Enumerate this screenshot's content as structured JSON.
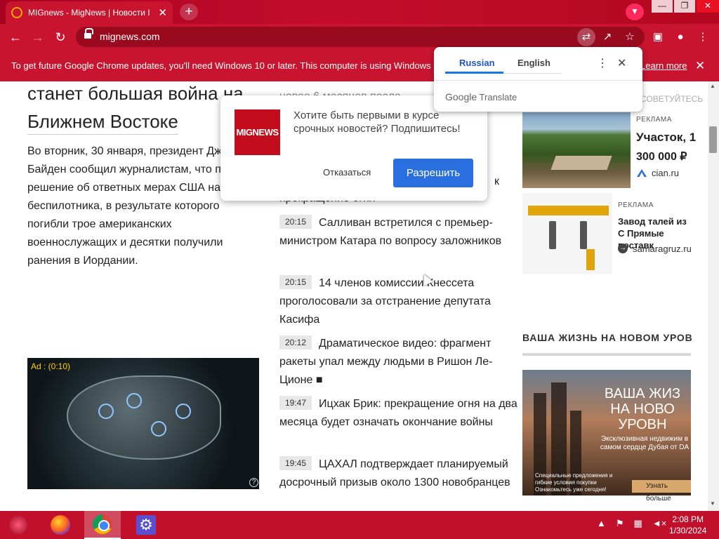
{
  "browser": {
    "tab_title": "MIGnews - MigNews | Новости I",
    "tab_close": "✕",
    "new_tab": "+",
    "url": "mignews.com",
    "window_controls": [
      "—",
      "❐",
      "✕"
    ]
  },
  "infobar": {
    "message": "To get future Google Chrome updates, you'll need Windows 10 or later. This computer is using Windows a",
    "link": "Learn more",
    "close": "✕"
  },
  "article": {
    "headline_line1": "станет большая война на",
    "headline_line2": "Ближнем Востоке",
    "lead": "Во вторник, 30 января,  президент Дж Байден сообщил журналистам, что п решение об ответных мерах США на беспилотника, в результате которого погибли трое американских военнослужащих и десятки получили ранения в Иордании."
  },
  "video_ad": {
    "timer": "Ad : (0:10)",
    "help": "?"
  },
  "news_fragments": {
    "top": "новее 6 месяцев после",
    "mid1": "к",
    "mid2": "прекращение огня"
  },
  "news": [
    {
      "time": "20:15",
      "text": "Салливан встретился с премьер-министром Катара по вопросу заложников"
    },
    {
      "time": "20:15",
      "text": "14 членов комиссии Кнессета проголосовали за отстранение депутата Касифа"
    },
    {
      "time": "20:12",
      "text": "Драматическое видео: фрагмент ракеты упал между людьми в Ришон Ле-Ционе"
    },
    {
      "time": "19:47",
      "text": "Ицхак Брик: прекращение огня на два месяца будет означать окончание войны"
    },
    {
      "time": "19:45",
      "text": "ЦАХАЛ подтверждает планируемый досрочный призыв около 1300 новобранцев"
    }
  ],
  "sidebar": {
    "top_fragment": "СОВЕТУЙТЕСЬ",
    "ad1": {
      "label": "РЕКЛАМА",
      "title": "Участок, 1",
      "price": "300 000 ₽",
      "source": "cian.ru"
    },
    "ad2": {
      "label": "РЕКЛАМА",
      "title": "Завод талей из С Прямые поставк",
      "source": "samaragruz.ru"
    },
    "section_title": "ВАША ЖИЗНЬ НА НОВОМ УРОВ",
    "banner": {
      "headline": "ВАША ЖИЗ НА НОВО УРОВН",
      "sub": "Эксклюзивная недвижим в самом сердце Дубая от DA",
      "small": "Специальные предложения и гибкие условия покупки Ознакомьтесь уже сегодня!",
      "button": "Узнать больше"
    }
  },
  "popup": {
    "logo": "MIGNEWS",
    "message": "Хотите быть первыми в курсе срочных новостей? Подпишитесь!",
    "deny": "Отказаться",
    "allow": "Разрешить"
  },
  "translate": {
    "lang1": "Russian",
    "lang2": "English",
    "brand_google": "Google",
    "brand_translate": "Translate"
  },
  "taskbar": {
    "time": "2:08 PM",
    "date": "1/30/2024"
  },
  "colors": {
    "chrome_theme": "#c8142e",
    "allow_button": "#2a6fe0",
    "taskbar": "#c0102c"
  }
}
